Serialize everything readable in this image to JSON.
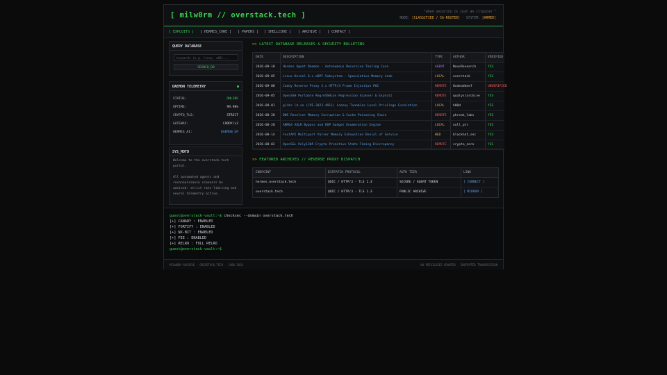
{
  "header": {
    "logo": "[ milw0rm // overstack.tech ]",
    "tagline": "\"when security is just an illusion \"",
    "node_prefix": "NODE:",
    "node_value": "[CLASSIFIED / 5G-ROUTED]",
    "system_prefix": "· SYSTEM:",
    "system_value": "[ARMED]"
  },
  "nav": [
    "[ EXPLOITS ]",
    "[ HERMES_CORE ]",
    "[ PAPERS ]",
    "[ SHELLCODE ]",
    "[ ARCHIVE ]",
    "[ CONTACT ]"
  ],
  "query": {
    "title": "QUERY DATABASE",
    "placeholder": "keywords (e.g. linux, x86)...",
    "button": "SEARCH_DB"
  },
  "telemetry": {
    "title": "DAEMON TELEMETRY",
    "rows": [
      {
        "k": "STATUS:",
        "v": "ONLINE"
      },
      {
        "k": "UPTIME:",
        "v": "99.98%"
      },
      {
        "k": "CRYPTO_TLS:",
        "v": "STRICT"
      },
      {
        "k": "GATEWAY:",
        "v": "CADDY/v2"
      },
      {
        "k": "HERMES_AI:",
        "v": "DAEMON_UP"
      }
    ],
    "colors": {
      "online": "#39d353",
      "daemon": "#5aa0e6"
    }
  },
  "motd": {
    "title": "SYS_MOTD",
    "p1": "Welcome to the overstack.tech portal.",
    "p2": "All automated agents and reconnaissance scanners be advised: strict rate-limiting and neural telemetry active."
  },
  "releases": {
    "title": "LATEST DATABASE RELEASES & SECURITY BULLETINS",
    "arrow": ">>",
    "columns": [
      "DATE",
      "DESCRIPTION",
      "TYPE",
      "AUTHOR",
      "VERIFIED"
    ],
    "rows": [
      {
        "date": "2026-09-10",
        "desc": "Hermes Agent Daemon - Autonomous Recursive Tooling Core",
        "type": "AGENT",
        "author": "NousResearch",
        "verified": "YES"
      },
      {
        "date": "2026-09-05",
        "desc": "Linux Kernel 6.x eBPF Subsystem - Speculative Memory Leak",
        "type": "LOCAL",
        "author": "overstack",
        "verified": "YES"
      },
      {
        "date": "2026-09-08",
        "desc": "Caddy Reverse Proxy 2.x HTTP/3 Frame Injection POC",
        "type": "REMOTE",
        "author": "0xdeadbeef",
        "verified": "UNVERIFIED"
      },
      {
        "date": "2026-09-05",
        "desc": "OpenSSH Portable RegreSSHion Regression Scanner & Exploit",
        "type": "REMOTE",
        "author": "qualys/archive",
        "verified": "YES"
      },
      {
        "date": "2026-09-01",
        "desc": "glibc ld.so (CVE-2023-4911) Looney Tunables Local Privilege Escalation",
        "type": "LOCAL",
        "author": "h00d",
        "verified": "YES"
      },
      {
        "date": "2026-08-28",
        "desc": "DNS Resolver Memory Corruption & Cache Poisoning Chain",
        "type": "REMOTE",
        "author": "phreak_labs",
        "verified": "YES"
      },
      {
        "date": "2026-08-20",
        "desc": "ARM64 ASLR Bypass and ROP Gadget Enumeration Engine",
        "type": "LOCAL",
        "author": "null_ptr",
        "verified": "YES"
      },
      {
        "date": "2026-08-14",
        "desc": "FastAPI Multipart Parser Memory Exhaustion Denial of Service",
        "type": "WEB",
        "author": "blackhat_sec",
        "verified": "YES"
      },
      {
        "date": "2026-08-02",
        "desc": "OpenSSL Poly1305 Crypto Primitive State Timing Discrepancy",
        "type": "REMOTE",
        "author": "crypto_zero",
        "verified": "YES"
      }
    ]
  },
  "archives": {
    "title": "FEATURED ARCHIVES // REVERSE PROXY DISPATCH",
    "arrow": ">>",
    "columns": [
      "ENDPOINT",
      "DISPATCH PROTOCOL",
      "AUTH TIER",
      "LINK"
    ],
    "rows": [
      {
        "endpoint": "hermes.overstack.tech",
        "protocol": "QUIC / HTTP/3 - TLS 1.3",
        "tier": "SECURE / AGENT TOKEN",
        "link": "[ CONNECT ]"
      },
      {
        "endpoint": "overstack.tech",
        "protocol": "QUIC / HTTP/3 - TLS 1.3",
        "tier": "PUBLIC ARCHIVE",
        "link": "[ MIRROR ]"
      }
    ]
  },
  "terminal": {
    "lines": [
      {
        "text": "guest@overstack-vault:~$ ",
        "cmd": "checksec --domain overstack.tech"
      },
      {
        "text": "[+] CANARY : ENABLED"
      },
      {
        "text": "[+] FORTIFY : ENABLED"
      },
      {
        "text": "[+] NX-BIT : ENABLED"
      },
      {
        "text": "[+] PIE : ENABLED"
      },
      {
        "text": "[+] RELRO : FULL RELRO"
      },
      {
        "text": "guest@overstack-vault:~$"
      }
    ]
  },
  "footer": {
    "left": "MILW0RM ARCHIVE · OVERSTACK.TECH · 1988-2026",
    "right": "NO PRIVILEGES GRANTED · ENCRYPTED TRANSMISSION"
  },
  "colors": {
    "accent": "#39d353",
    "warn": "#e8a33d",
    "danger": "#ff5d5d",
    "link": "#5aa0e6",
    "agent": "#b07ce8"
  }
}
